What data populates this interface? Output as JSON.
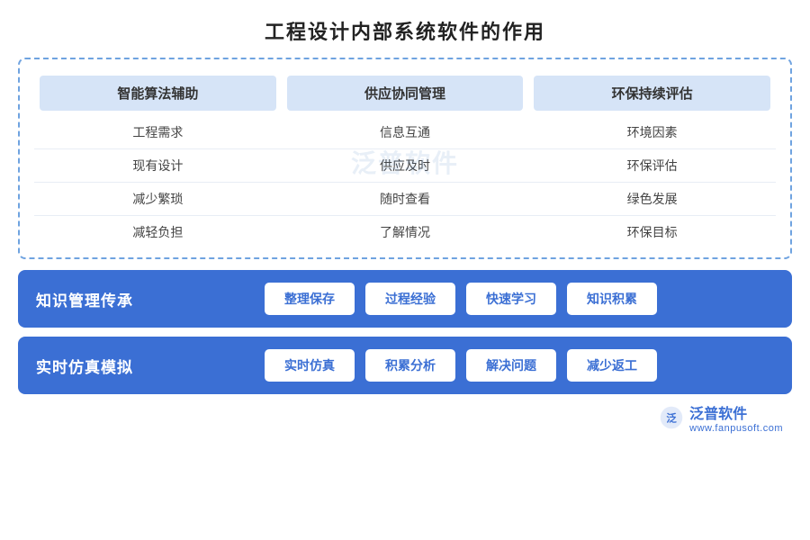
{
  "title": "工程设计内部系统软件的作用",
  "upper_section": {
    "headers": [
      "智能算法辅助",
      "供应协同管理",
      "环保持续评估"
    ],
    "rows": [
      [
        "工程需求",
        "信息互通",
        "环境因素"
      ],
      [
        "现有设计",
        "供应及时",
        "环保评估"
      ],
      [
        "减少繁琐",
        "随时查看",
        "绿色发展"
      ],
      [
        "减轻负担",
        "了解情况",
        "环保目标"
      ]
    ]
  },
  "blue_sections": [
    {
      "title": "知识管理传承",
      "chips": [
        "整理保存",
        "过程经验",
        "快速学习",
        "知识积累"
      ]
    },
    {
      "title": "实时仿真模拟",
      "chips": [
        "实时仿真",
        "积累分析",
        "解决问题",
        "减少返工"
      ]
    }
  ],
  "watermark": "泛普软件",
  "footer": {
    "logo_text": "泛普软件",
    "logo_sub": "www.fanpusoft.com"
  }
}
